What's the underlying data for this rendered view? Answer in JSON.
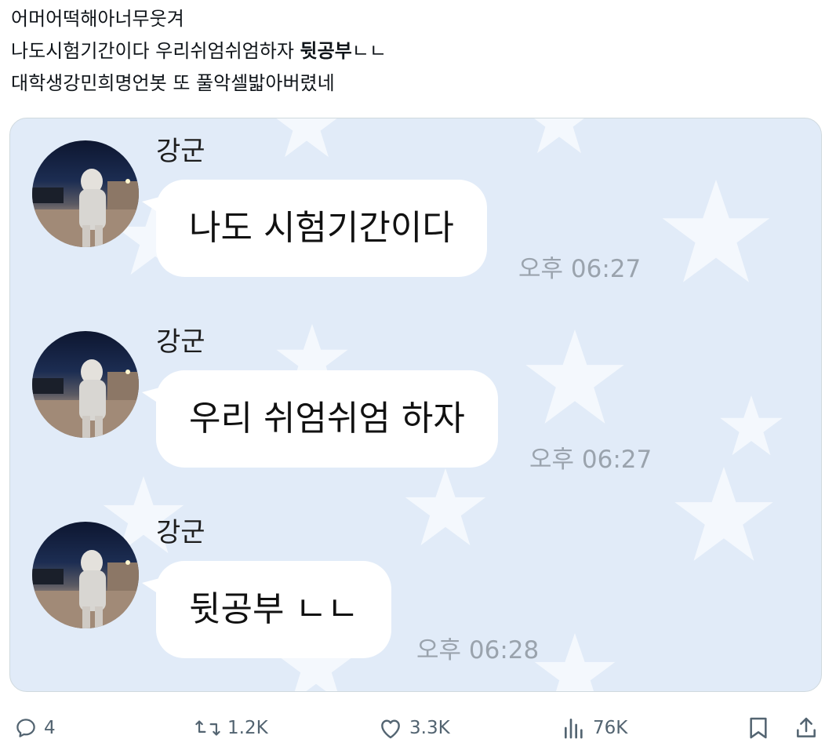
{
  "tweet": {
    "lines": [
      {
        "text": "어머어떡해아너무웃겨"
      },
      {
        "text_before": "나도시험기간이다 우리쉬엄쉬엄하자 ",
        "bold": "뒷공부",
        "text_after": "ㄴㄴ"
      },
      {
        "text": "대학생강민희명언봇 또 풀악셀밟아버렸네"
      }
    ]
  },
  "chat": {
    "messages": [
      {
        "sender": "강군",
        "text": "나도 시험기간이다",
        "time": "오후 06:27"
      },
      {
        "sender": "강군",
        "text": "우리 쉬엄쉬엄 하자",
        "time": "오후 06:27"
      },
      {
        "sender": "강군",
        "text": "뒷공부 ㄴㄴ",
        "time": "오후 06:28"
      }
    ]
  },
  "actions": {
    "replies": "4",
    "retweets": "1.2K",
    "likes": "3.3K",
    "views": "76K"
  },
  "icons": {
    "reply": "reply-icon",
    "retweet": "retweet-icon",
    "like": "heart-icon",
    "views": "views-icon",
    "bookmark": "bookmark-icon",
    "share": "share-icon"
  },
  "colors": {
    "chat_background": "#e1ebf8",
    "action_gray": "#536471",
    "timestamp_gray": "#9aa3ad"
  }
}
